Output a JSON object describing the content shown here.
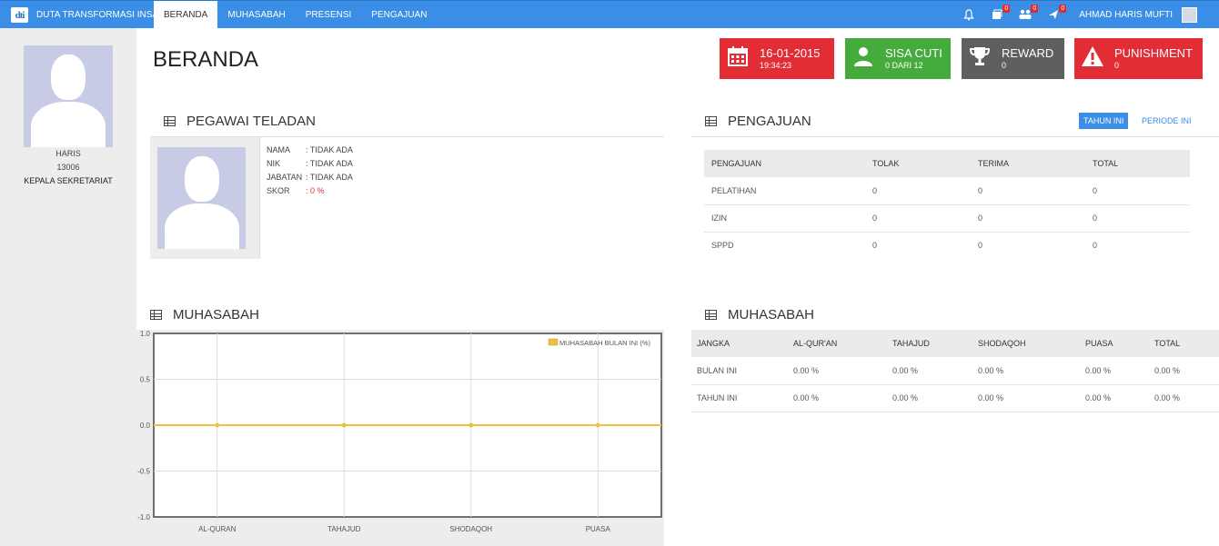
{
  "header": {
    "brand": "DUTA TRANSFORMASI INSANI",
    "logo_text": "dti",
    "nav": [
      "BERANDA",
      "MUHASABAH",
      "PRESENSI",
      "PENGAJUAN"
    ],
    "icons": [
      {
        "name": "bell-icon",
        "badge": ""
      },
      {
        "name": "book-icon",
        "badge": "0"
      },
      {
        "name": "users-icon",
        "badge": "0"
      },
      {
        "name": "plane-icon",
        "badge": "0"
      }
    ],
    "username": "AHMAD HARIS MUFTI"
  },
  "sidebar": {
    "name": "HARIS",
    "nik": "13006",
    "position": "KEPALA SEKRETARIAT"
  },
  "page_title": "BERANDA",
  "stats": [
    {
      "big": "16-01-2015",
      "small": "19:34:23",
      "color": "#e22c36",
      "icon": "calendar-icon"
    },
    {
      "big": "SISA CUTI",
      "small": "0 DARI 12",
      "color": "#45ab3c",
      "icon": "user-icon"
    },
    {
      "big": "REWARD",
      "small": "0",
      "color": "#5f5f5f",
      "icon": "trophy-icon"
    },
    {
      "big": "PUNISHMENT",
      "small": "0",
      "color": "#e22c36",
      "icon": "warning-icon"
    }
  ],
  "pegawai": {
    "title": "PEGAWAI TELADAN",
    "rows": [
      {
        "key": "NAMA",
        "value": ": TIDAK ADA"
      },
      {
        "key": "NIK",
        "value": ": TIDAK ADA"
      },
      {
        "key": "JABATAN",
        "value": ": TIDAK ADA"
      },
      {
        "key": "SKOR",
        "value": ": 0 %"
      }
    ]
  },
  "pengajuan": {
    "title": "PENGAJUAN",
    "btn_tahun": "TAHUN INI",
    "btn_periode": "PERIODE INI",
    "headers": [
      "PENGAJUAN",
      "TOLAK",
      "TERIMA",
      "TOTAL"
    ],
    "rows": [
      [
        "PELATIHAN",
        "0",
        "0",
        "0"
      ],
      [
        "IZIN",
        "0",
        "0",
        "0"
      ],
      [
        "SPPD",
        "0",
        "0",
        "0"
      ]
    ]
  },
  "muhasabah_chart": {
    "title": "MUHASABAH"
  },
  "muhasabah_table": {
    "title": "MUHASABAH",
    "headers": [
      "JANGKA",
      "AL-QUR'AN",
      "TAHAJUD",
      "SHODAQOH",
      "PUASA",
      "TOTAL"
    ],
    "rows": [
      [
        "BULAN INI",
        "0.00 %",
        "0.00 %",
        "0.00 %",
        "0.00 %",
        "0.00 %"
      ],
      [
        "TAHUN INI",
        "0.00 %",
        "0.00 %",
        "0.00 %",
        "0.00 %",
        "0.00 %"
      ]
    ]
  },
  "chart_data": {
    "type": "line",
    "categories": [
      "AL-QURAN",
      "TAHAJUD",
      "SHODAQOH",
      "PUASA"
    ],
    "series": [
      {
        "name": "MUHASABAH BULAN INI (%)",
        "values": [
          0,
          0,
          0,
          0
        ],
        "color": "#f0c040"
      }
    ],
    "ylim": [
      -1.0,
      1.0
    ],
    "yticks": [
      "1.0",
      "0.5",
      "0.0",
      "-0.5",
      "-1.0"
    ],
    "grid": true,
    "legend": "top-right"
  }
}
